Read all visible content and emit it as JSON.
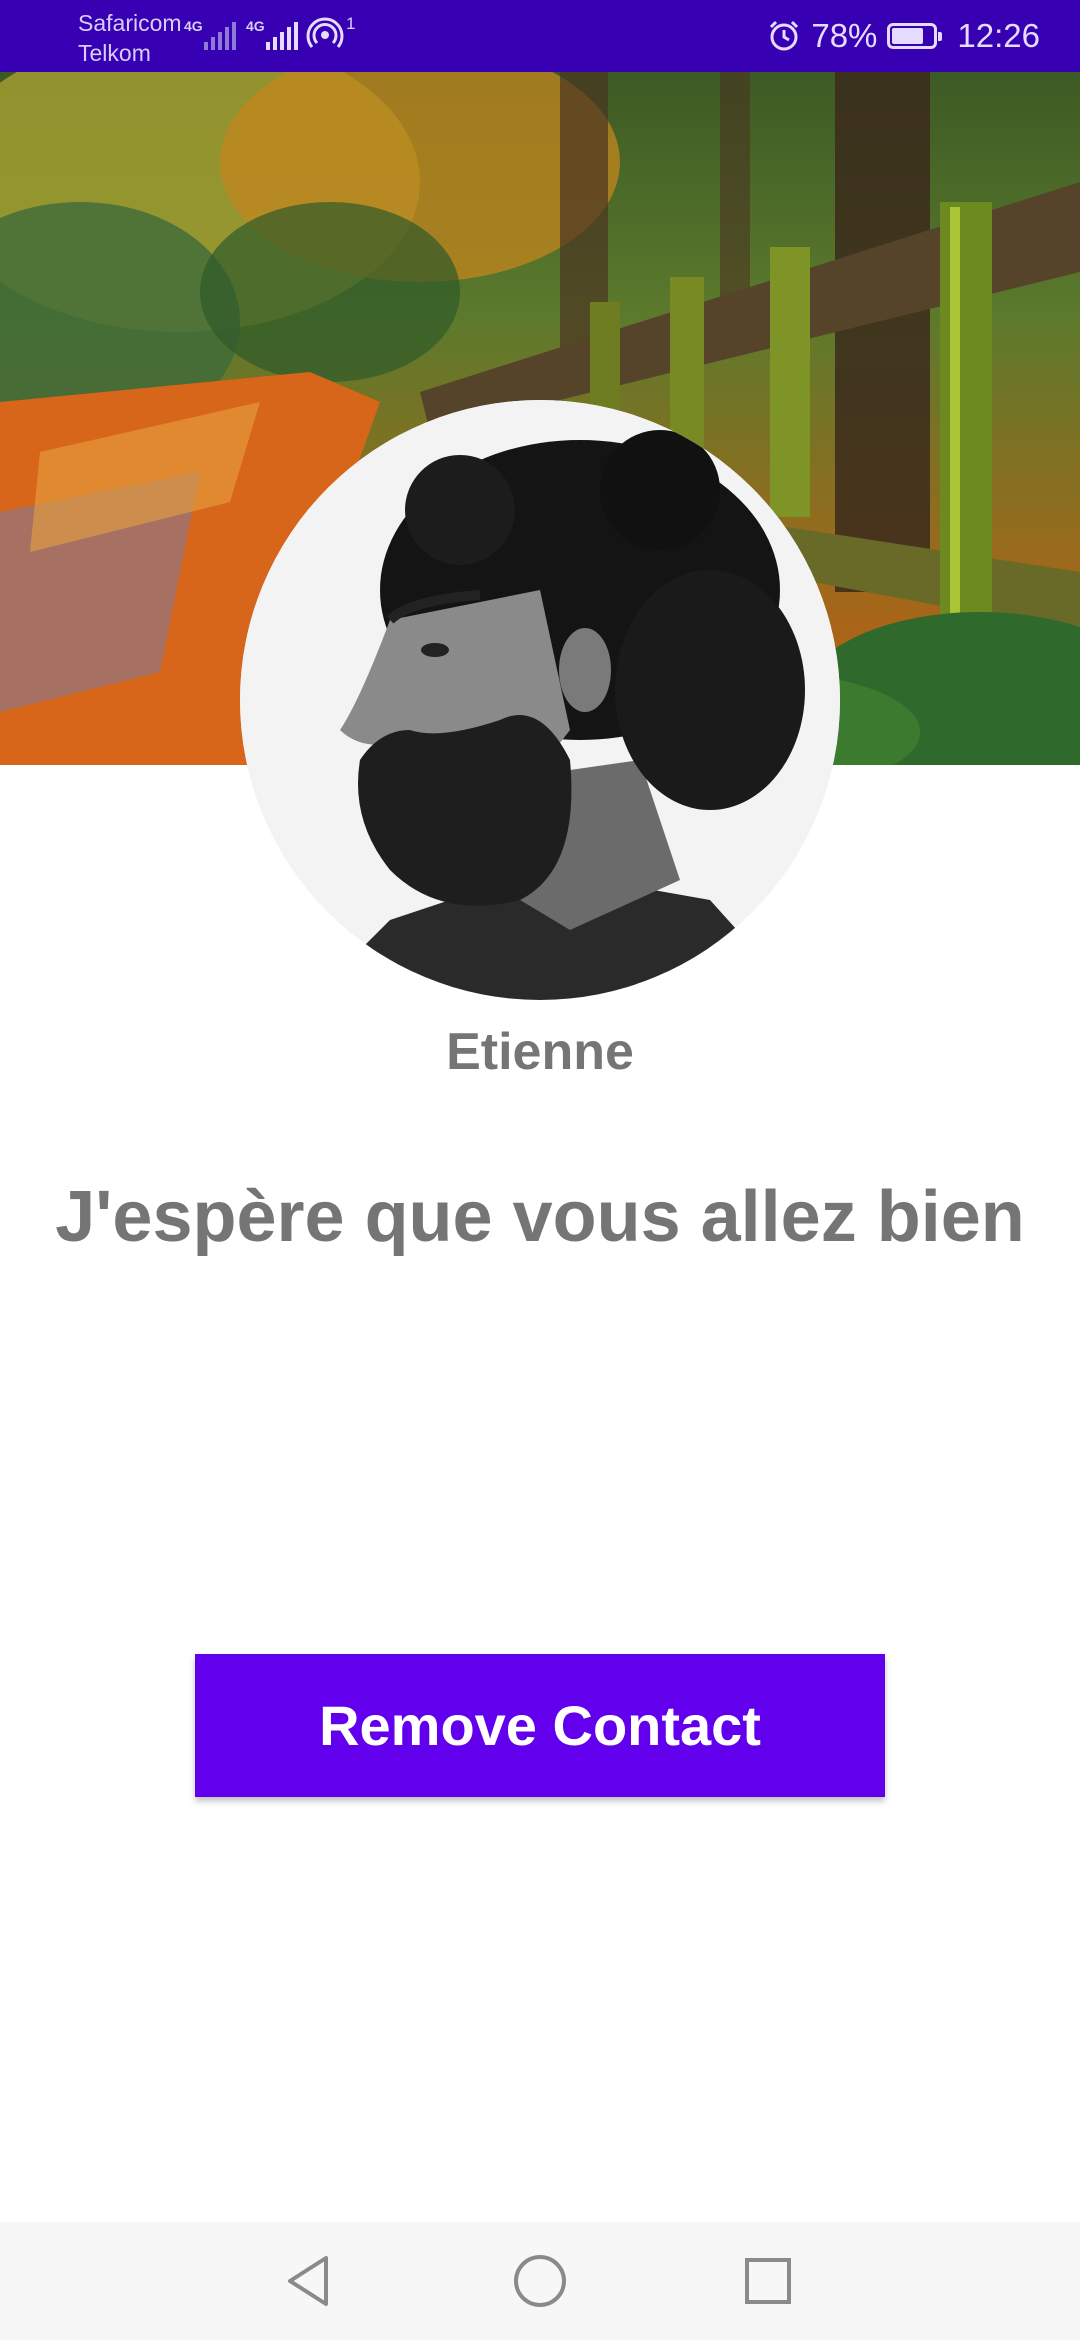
{
  "status_bar": {
    "carrier_1": "Safaricom",
    "carrier_2": "Telkom",
    "network_1": "4G",
    "network_2": "4G",
    "hotspot_count": "1",
    "battery_percent": "78%",
    "battery_level": 0.78,
    "time": "12:26",
    "icons": [
      "signal-icon",
      "signal-icon",
      "hotspot-icon",
      "alarm-icon",
      "battery-icon"
    ]
  },
  "profile": {
    "cover_image": "autumn-path-photo",
    "avatar_image": "bearded-man-portrait",
    "name": "Etienne",
    "message": "J'espère que vous allez bien"
  },
  "actions": {
    "remove_label": "Remove Contact"
  },
  "colors": {
    "status_bar": "#3700b3",
    "accent": "#6200ee",
    "text_gray": "#757575"
  },
  "nav_bar": {
    "icons": [
      "back-icon",
      "home-icon",
      "recents-icon"
    ]
  }
}
